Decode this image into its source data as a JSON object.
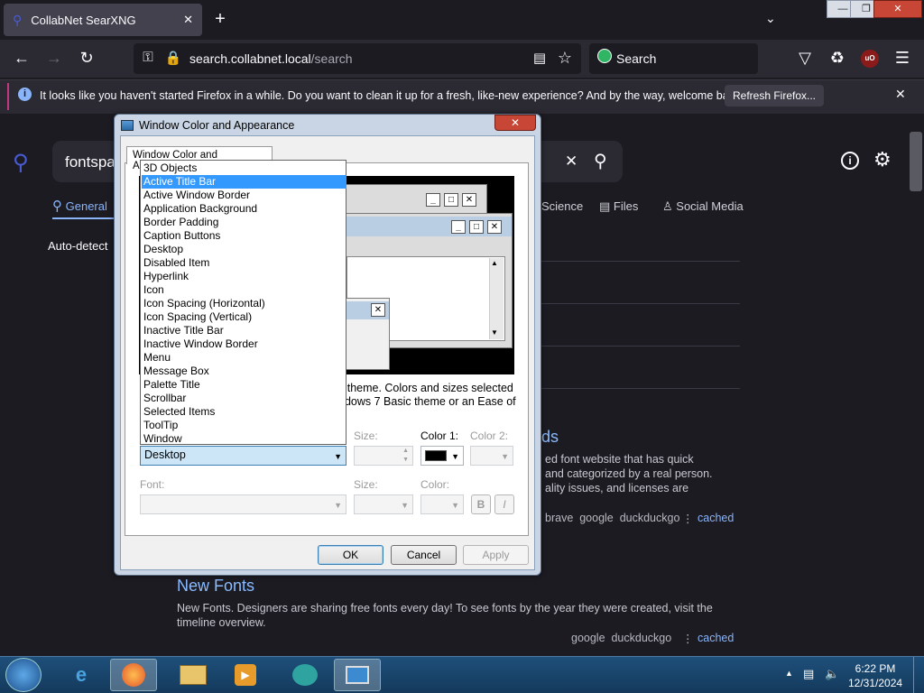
{
  "browser": {
    "tab_title": "CollabNet SearXNG",
    "new_tab_label": "+",
    "url_domain": "search.collabnet.local",
    "url_path": "/search",
    "search_placeholder": "Search",
    "notification": "It looks like you haven't started Firefox in a while. Do you want to clean it up for a fresh, like-new experience? And by the way, welcome back!",
    "refresh_button": "Refresh Firefox...",
    "window_buttons": [
      "—",
      "❐",
      "✕"
    ]
  },
  "searx": {
    "query": "fontspa",
    "categories": [
      "General",
      "Science",
      "Files",
      "Social Media"
    ],
    "autodetect": "Auto-detect",
    "results": [
      {
        "title_suffix": "ds",
        "text": [
          "ed font website that has quick",
          "and categorized by a real person.",
          "ality issues, and licenses are"
        ],
        "engines": "brave  google  duckduckgo",
        "cached": "cached"
      },
      {
        "title": "New Fonts",
        "text": [
          "New Fonts. Designers are sharing free fonts every day! To see fonts by the year they were created, visit the",
          "timeline overview."
        ],
        "engines": "google  duckduckgo",
        "cached": "cached"
      }
    ]
  },
  "dialog": {
    "title": "Window Color and Appearance",
    "tab": "Window Color and Appearance",
    "close": "✕",
    "desc_line1": "s theme.  Colors and sizes selected",
    "desc_line2": "ndows 7 Basic theme or an Ease of",
    "item_selected": "Desktop",
    "dropdown_items": [
      "3D Objects",
      "Active Title Bar",
      "Active Window Border",
      "Application Background",
      "Border Padding",
      "Caption Buttons",
      "Desktop",
      "Disabled Item",
      "Hyperlink",
      "Icon",
      "Icon Spacing (Horizontal)",
      "Icon Spacing (Vertical)",
      "Inactive Title Bar",
      "Inactive Window Border",
      "Menu",
      "Message Box",
      "Palette Title",
      "Scrollbar",
      "Selected Items",
      "ToolTip",
      "Window"
    ],
    "dropdown_highlight_index": 1,
    "labels": {
      "size": "Size:",
      "color1": "Color 1:",
      "color2": "Color 2:",
      "font": "Font:",
      "font_size": "Size:",
      "font_color": "Color:",
      "bold": "B",
      "italic": "I"
    },
    "buttons": {
      "ok": "OK",
      "cancel": "Cancel",
      "apply": "Apply"
    },
    "color1_value": "#000000"
  },
  "taskbar": {
    "time": "6:22 PM",
    "date": "12/31/2024"
  }
}
